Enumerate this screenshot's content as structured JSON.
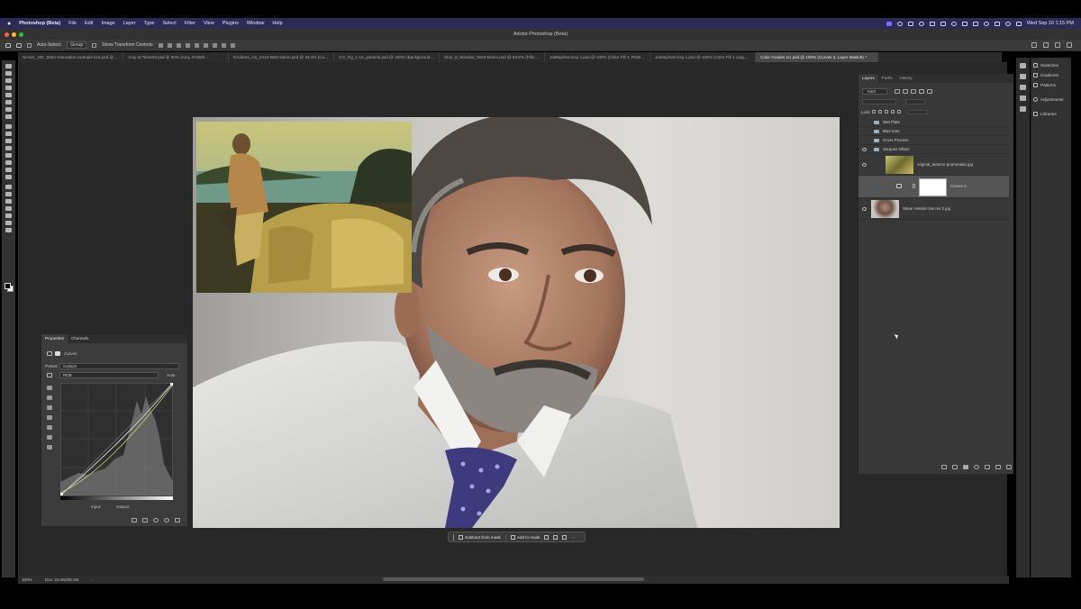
{
  "menubar": {
    "app_name": "Photoshop (Beta)",
    "items": [
      "File",
      "Edit",
      "Image",
      "Layer",
      "Type",
      "Select",
      "Filter",
      "View",
      "Plugins",
      "Window",
      "Help"
    ],
    "clock": "Wed Sep 10  1:15 PM"
  },
  "titlebar": {
    "title": "Adobe Photoshop (Beta)"
  },
  "options": {
    "auto_select": "Auto-Select:",
    "auto_select_value": "Group",
    "show_transform": "Show Transform Controls"
  },
  "doc_tabs": [
    "NI-ves _MC_5562 Saturation example k1a.psd @ 100% (D...",
    "Amy at Taheet3.psd @ 50% (Amy, RGB/8...",
    "DAdams_AS_2413-W20 Demo.psd @ 33.3% (Curves 1, Lay...",
    "CO_Fig_1-10_guitarist.psd @ 100% (Background, RGB/...",
    "Shot_8_Window_0053-Demo.psd @ 63.9% (Pillow Hue/Sat...",
    "JaiMayhew Exp 2.psd @ 100% (Color Fill 1, RGB/...",
    "JaiMayhew Exp 1.psd @ 100% (Color Fill 1 copy, RGB/...",
    "Color Grades w1.psd @ 100% (Curves 3, Layer Mask/8) *"
  ],
  "properties": {
    "tab_properties": "Properties",
    "tab_channels": "Channels",
    "adjustment": "Curves",
    "preset_label": "Preset:",
    "preset_value": "Custom",
    "channel_value": "RGB",
    "auto_label": "Auto",
    "input_label": "Input:",
    "output_label": "Output:"
  },
  "layers": {
    "tab_layers": "Layers",
    "tab_paths": "Paths",
    "tab_history": "History",
    "filter_kind": "Kind",
    "lock_label": "Lock:",
    "rows": [
      {
        "name": "Wet Plate",
        "type": "group"
      },
      {
        "name": "Blue tone",
        "type": "group"
      },
      {
        "name": "Cross Process",
        "type": "group"
      },
      {
        "name": "Jacques Olivier",
        "type": "group"
      },
      {
        "name": "original_autumn-promenade.jpg",
        "type": "image"
      },
      {
        "name": "Curves 3",
        "type": "adjustment"
      },
      {
        "name": "Steve Hessler low res 2.jpg",
        "type": "image"
      }
    ]
  },
  "rightbar": {
    "items": [
      "Swatches",
      "Gradients",
      "Patterns",
      "Adjustments",
      "Libraries"
    ]
  },
  "taskbar": {
    "subtract": "Subtract from mask",
    "add": "Add to mask"
  },
  "status": {
    "zoom": "100%",
    "doc": "Doc: 23.0M/88.4M"
  },
  "colors": {
    "menubar_bg": "#2b2b55",
    "workspace_bg": "#282828",
    "panel_bg": "#383838"
  }
}
